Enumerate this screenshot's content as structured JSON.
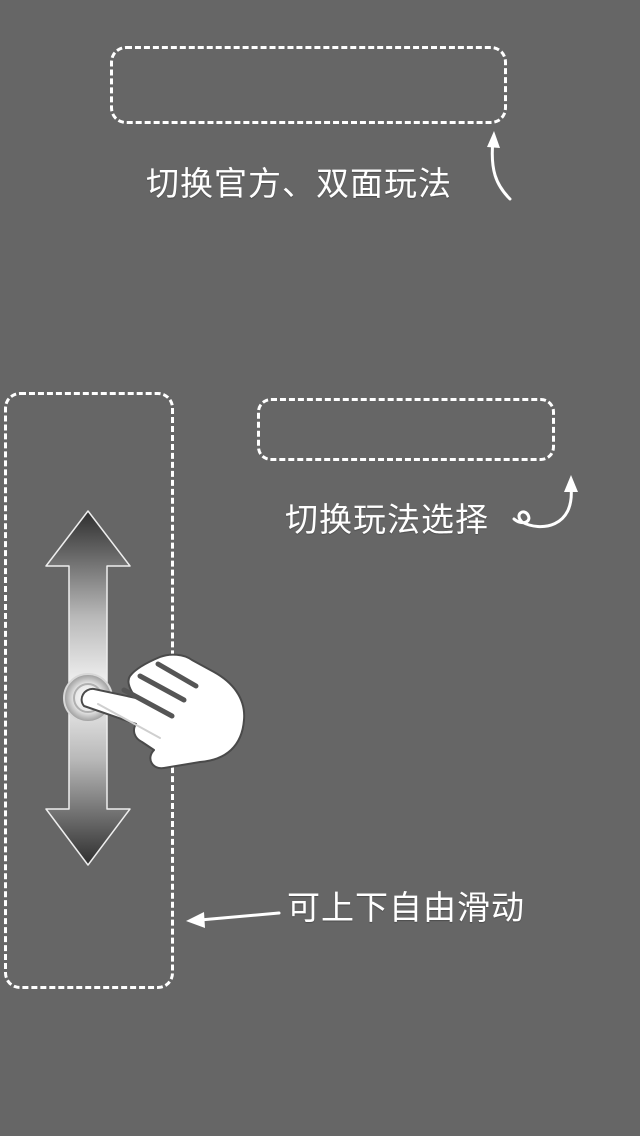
{
  "tips": {
    "switch_mode": "切换官方、双面玩法",
    "switch_play": "切换玩法选择",
    "slide_freely": "可上下自由滑动"
  },
  "icons": {
    "slide_arrow": "vertical-double-arrow-icon",
    "hand": "pointing-hand-icon",
    "curved_arrow_1": "curved-arrow-icon",
    "curved_arrow_2": "curly-arrow-icon",
    "straight_arrow": "left-arrow-icon"
  },
  "colors": {
    "overlay_bg": "#666666",
    "guide_stroke": "#ffffff"
  }
}
